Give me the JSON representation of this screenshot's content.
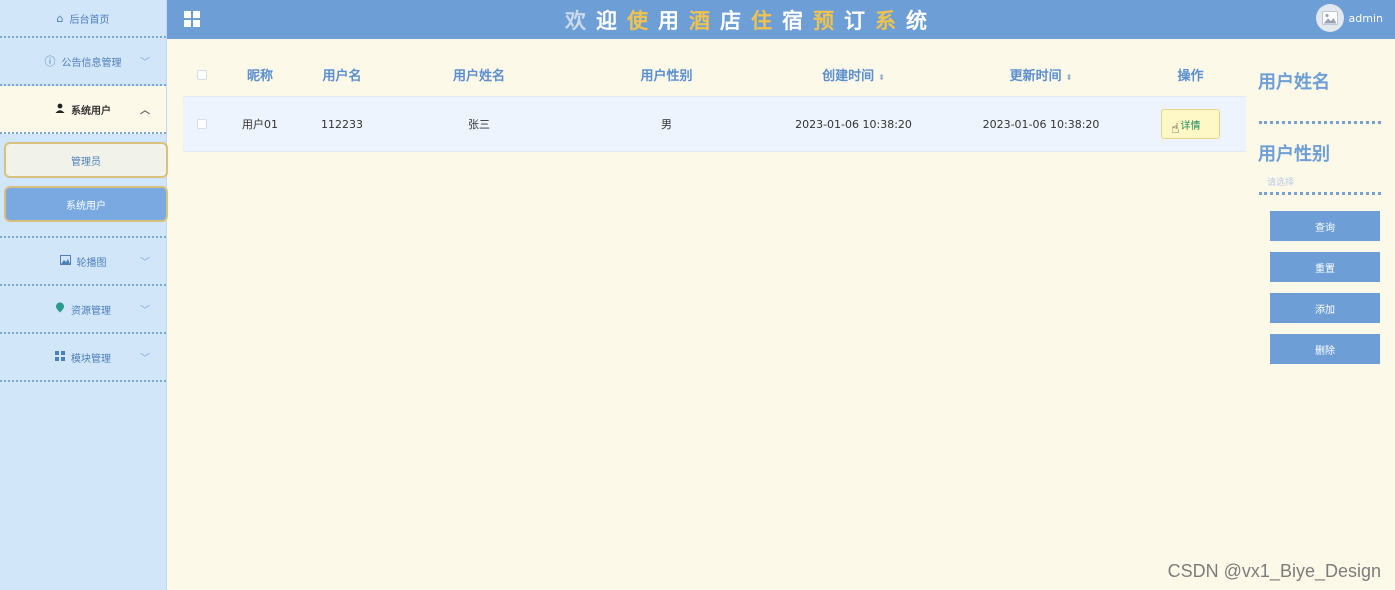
{
  "sidebar": {
    "home": "后台首页",
    "groups": [
      {
        "label": "公告信息管理",
        "icon": "info-circle-icon"
      },
      {
        "label": "系统用户",
        "icon": "user-icon"
      },
      {
        "label": "轮播图",
        "icon": "image-icon"
      },
      {
        "label": "资源管理",
        "icon": "location-icon"
      },
      {
        "label": "模块管理",
        "icon": "grid-icon"
      }
    ],
    "sub_items": [
      "管理员",
      "系统用户"
    ]
  },
  "header": {
    "title_chars": [
      "欢",
      "迎",
      "使",
      "用",
      "酒",
      "店",
      "住",
      "宿",
      "预",
      "订",
      "系",
      "统"
    ],
    "username": "admin"
  },
  "table": {
    "headers": {
      "nickname": "昵称",
      "username": "用户名",
      "realname": "用户姓名",
      "gender": "用户性别",
      "created": "创建时间",
      "updated": "更新时间",
      "operation": "操作"
    },
    "rows": [
      {
        "nickname": "用户01",
        "username": "112233",
        "realname": "张三",
        "gender": "男",
        "created": "2023-01-06 10:38:20",
        "updated": "2023-01-06 10:38:20",
        "action": "详情"
      }
    ]
  },
  "filter": {
    "name_label": "用户姓名",
    "gender_label": "用户性别",
    "gender_placeholder": "请选择",
    "buttons": {
      "query": "查询",
      "reset": "重置",
      "add": "添加",
      "delete": "删除"
    }
  },
  "colors": {
    "header_bg": "#6d9fd6",
    "sidebar_bg": "#d2e6fa",
    "main_bg": "#fdf9e9",
    "accent_yellow": "#f0c24f"
  },
  "watermark": "CSDN @vx1_Biye_Design"
}
